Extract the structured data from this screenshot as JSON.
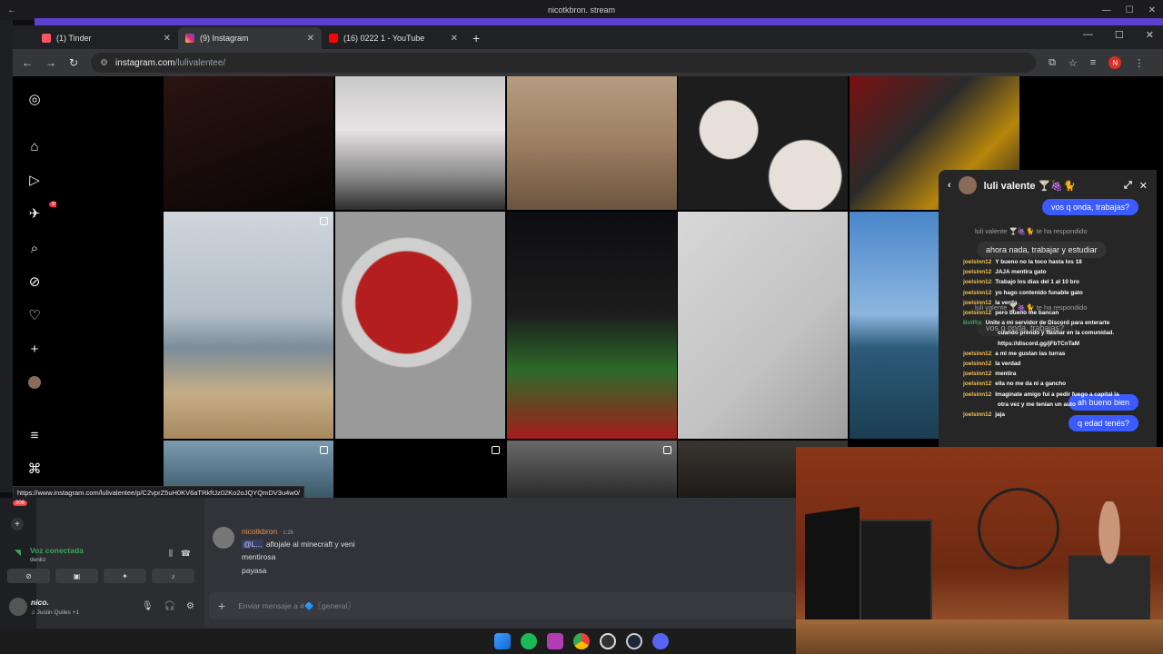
{
  "top_title": "nicotkbron. stream",
  "tabs": [
    {
      "label": "(1) Tinder",
      "color": "#fd5564"
    },
    {
      "label": "(9) Instagram",
      "color": "#d62976"
    },
    {
      "label": "(16) 0222 1 - YouTube",
      "color": "#ff0000"
    }
  ],
  "address": {
    "host": "instagram.com",
    "path": "/lulivalentee/"
  },
  "profile_initial": "N",
  "ig_sidebar": {
    "notif_badge": "9+"
  },
  "chat": {
    "title": "luli valente 🍸🍇🐈",
    "messages": {
      "m1": "vos q onda, trabajas?",
      "sys1": "luli valente 🍸🍇🐈 te ha respondido",
      "m2": "ahora nada, trabajar y estudiar",
      "sys2": "luli valente 🍸🍇🐈 te ha respondido",
      "m3": "vos q onda, trabajas?",
      "m4": "ah bueno bien",
      "m5": "q edad tenés?"
    }
  },
  "stream_chat": [
    {
      "user": "joelsinn12",
      "msg": "Y bueno no la toco hasta los 18"
    },
    {
      "user": "joelsinn12",
      "msg": "JAJA mentira gato"
    },
    {
      "user": "joelsinn12",
      "msg": "Trabajo los dias del 1 al 10 bro"
    },
    {
      "user": "joelsinn12",
      "msg": "yo hago contenido funable gato"
    },
    {
      "user": "joelsinn12",
      "msg": "la verda"
    },
    {
      "user": "joelsinn12",
      "msg": "pero bueno me bancan"
    },
    {
      "user": "BotRix",
      "msg": "Unite a mi servidor de Discord para enterarte"
    },
    {
      "user": "",
      "msg": "cuando prendo y flashar en la comunidad."
    },
    {
      "user": "",
      "msg": "https://discord.gg/jFbTCnTaM"
    },
    {
      "user": "joelsinn12",
      "msg": "a mi me gustan las turras"
    },
    {
      "user": "joelsinn12",
      "msg": "la verdad"
    },
    {
      "user": "joelsinn12",
      "msg": "mentira"
    },
    {
      "user": "joelsinn12",
      "msg": "ella no me da ni a gancho"
    },
    {
      "user": "joelsinn12",
      "msg": "Imaginate amigo fui a pedir fuego a capital la"
    },
    {
      "user": "",
      "msg": "otra vez y me tenian un auto"
    },
    {
      "user": "joelsinn12",
      "msg": "jaja"
    }
  ],
  "status_url": "https://www.instagram.com/lulivalentee/p/C2vprZ5uH0KV6aTRkftJz02Ko2oJQYQmDV3u4w0/",
  "discord": {
    "badge": "306",
    "voice_status": "Voz conectada",
    "voice_channel": "denkz",
    "user_name": "nico.",
    "user_status": "♫ Justin Quiles +1",
    "message": {
      "author": "nicotkbron",
      "time": "1:26",
      "mention": "@L...",
      "line1": "aflojale al minecraft y veni",
      "line2": "mentirosa",
      "line3": "payasa"
    },
    "composer_placeholder": "Enviar mensaje a #🔷〖general〗"
  }
}
